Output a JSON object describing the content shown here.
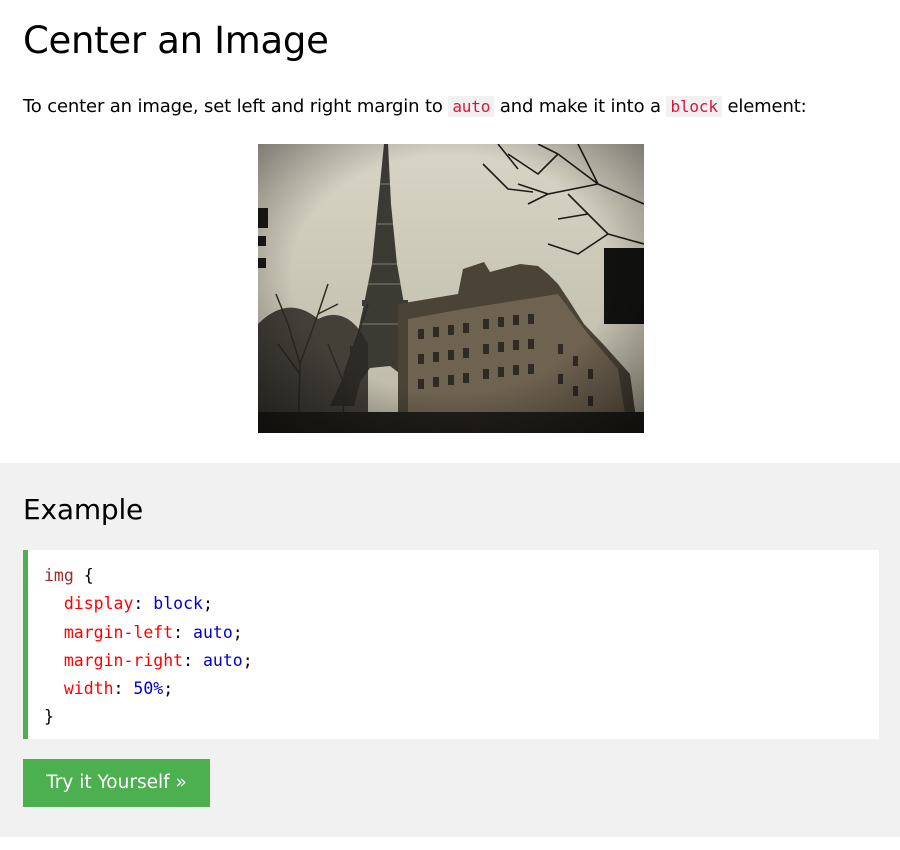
{
  "page": {
    "title": "Center an Image",
    "intro": {
      "before": "To center an image, set left and right margin to ",
      "code1": "auto",
      "middle": " and make it into a ",
      "code2": "block",
      "after": " element:"
    }
  },
  "image": {
    "subject": "eiffel-tower-photo"
  },
  "example": {
    "heading": "Example",
    "code": {
      "selector": "img",
      "open_brace": " {",
      "close_brace": "}",
      "declarations": [
        {
          "property": "display",
          "value": "block"
        },
        {
          "property": "margin-left",
          "value": "auto"
        },
        {
          "property": "margin-right",
          "value": "auto"
        },
        {
          "property": "width",
          "value": "50%"
        }
      ]
    },
    "button_label": "Try it Yourself »"
  },
  "colors": {
    "accent_green": "#4caf50",
    "panel_gray": "#f1f1f1",
    "inline_code_red": "#dc143c",
    "css_selector": "#a52a2a",
    "css_property": "#ff0000",
    "css_value": "#0000cd"
  }
}
